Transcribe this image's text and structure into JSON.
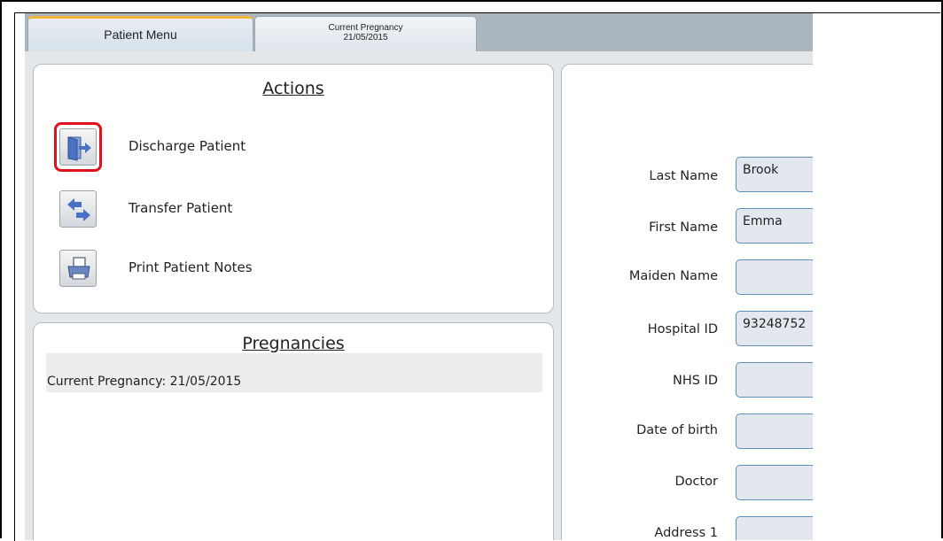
{
  "tabs": {
    "patient_menu": "Patient Menu",
    "current_pregnancy_line1": "Current Pregnancy",
    "current_pregnancy_line2": "21/05/2015"
  },
  "actions": {
    "title": "Actions",
    "items": [
      {
        "label": "Discharge Patient",
        "icon": "discharge-door-icon"
      },
      {
        "label": "Transfer Patient",
        "icon": "transfer-arrows-icon"
      },
      {
        "label": "Print Patient Notes",
        "icon": "printer-icon"
      }
    ]
  },
  "pregnancies": {
    "title": "Pregnancies",
    "items": [
      "Current Pregnancy: 21/05/2015"
    ]
  },
  "patient": {
    "fields": [
      {
        "label": "Last Name",
        "value": "Brook"
      },
      {
        "label": "First Name",
        "value": "Emma"
      },
      {
        "label": "Maiden Name",
        "value": ""
      },
      {
        "label": "Hospital ID",
        "value": "93248752"
      },
      {
        "label": "NHS ID",
        "value": ""
      },
      {
        "label": "Date of birth",
        "value": ""
      },
      {
        "label": "Doctor",
        "value": ""
      },
      {
        "label": "Address 1",
        "value": ""
      }
    ]
  },
  "colors": {
    "highlight": "#e0101d",
    "active_tab_accent": "#f2b33b",
    "icon_blue": "#4a72c4"
  }
}
